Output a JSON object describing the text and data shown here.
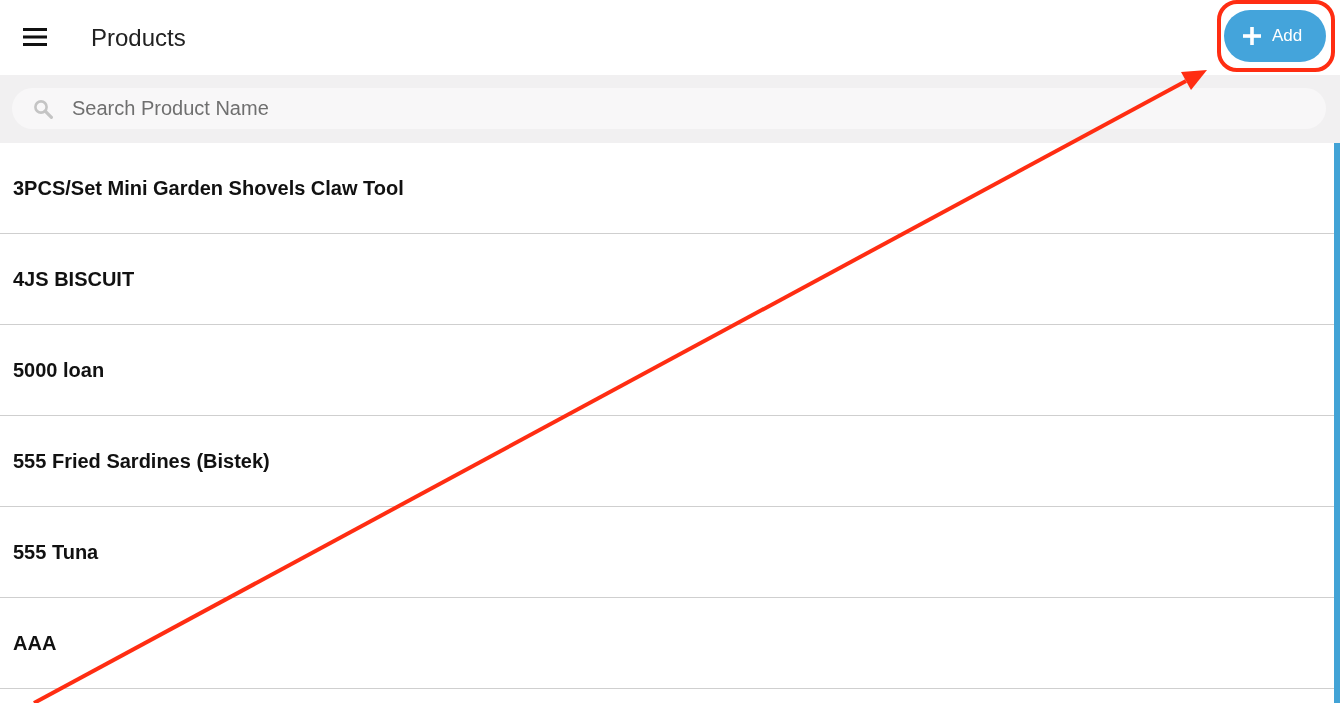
{
  "app_bar": {
    "title": "Products",
    "add_button": {
      "label": "Add"
    }
  },
  "search": {
    "placeholder": "Search Product Name"
  },
  "products": [
    {
      "name": "3PCS/Set Mini Garden Shovels Claw Tool"
    },
    {
      "name": "4JS BISCUIT"
    },
    {
      "name": "5000 loan"
    },
    {
      "name": "555 Fried Sardines (Bistek)"
    },
    {
      "name": "555 Tuna"
    },
    {
      "name": "AAA"
    }
  ]
}
